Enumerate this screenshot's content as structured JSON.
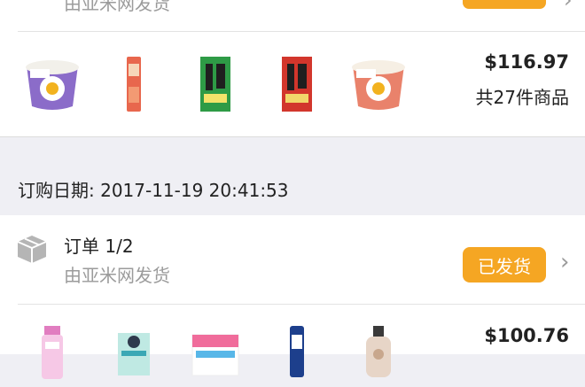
{
  "order_top": {
    "shipping_text": "由亚米网发货",
    "price": "$116.97",
    "item_count": "共27件商品",
    "thumbnails": [
      "noodle-bowl",
      "snack-stick-red",
      "seaweed-green",
      "seaweed-red",
      "noodle-bowl-2"
    ]
  },
  "date_section": {
    "label": "订购日期: 2017-11-19 20:41:53"
  },
  "order_bottom": {
    "title": "订单 1/2",
    "shipping_text": "由亚米网发货",
    "status_badge": "已发货",
    "price": "$100.76",
    "thumbnails": [
      "pink-bottle",
      "mask-pack",
      "pink-box",
      "blue-tube",
      "lotion-bottle"
    ]
  },
  "colors": {
    "badge": "#f5a623",
    "background": "#efeff4"
  }
}
